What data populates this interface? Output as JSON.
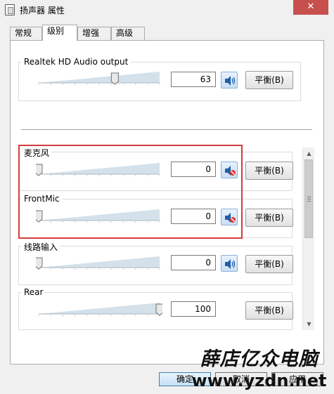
{
  "window": {
    "title": "扬声器 属性",
    "close_label": "✕"
  },
  "tabs": [
    {
      "label": "常规"
    },
    {
      "label": "级别"
    },
    {
      "label": "增强"
    },
    {
      "label": "高级"
    }
  ],
  "active_tab": 1,
  "output": {
    "name": "Realtek HD Audio output",
    "value": "63",
    "level": 0.63,
    "balance_label": "平衡(B)",
    "muted": false
  },
  "inputs": [
    {
      "name": "麦克风",
      "value": "0",
      "level": 0,
      "balance_label": "平衡(B)",
      "muted": true
    },
    {
      "name": "FrontMic",
      "value": "0",
      "level": 0,
      "balance_label": "平衡(B)",
      "muted": true
    },
    {
      "name": "线路输入",
      "value": "0",
      "level": 0,
      "balance_label": "平衡(B)",
      "muted": false
    },
    {
      "name": "Rear",
      "value": "100",
      "level": 1.0,
      "balance_label": "平衡(B)"
    }
  ],
  "buttons": {
    "ok": "确定",
    "cancel": "取消",
    "apply": "应用"
  },
  "watermark": {
    "text": "薛店亿众电脑",
    "url": "www.yzdn.net"
  },
  "colors": {
    "highlight": "#d63b3b",
    "close": "#c7504f"
  }
}
